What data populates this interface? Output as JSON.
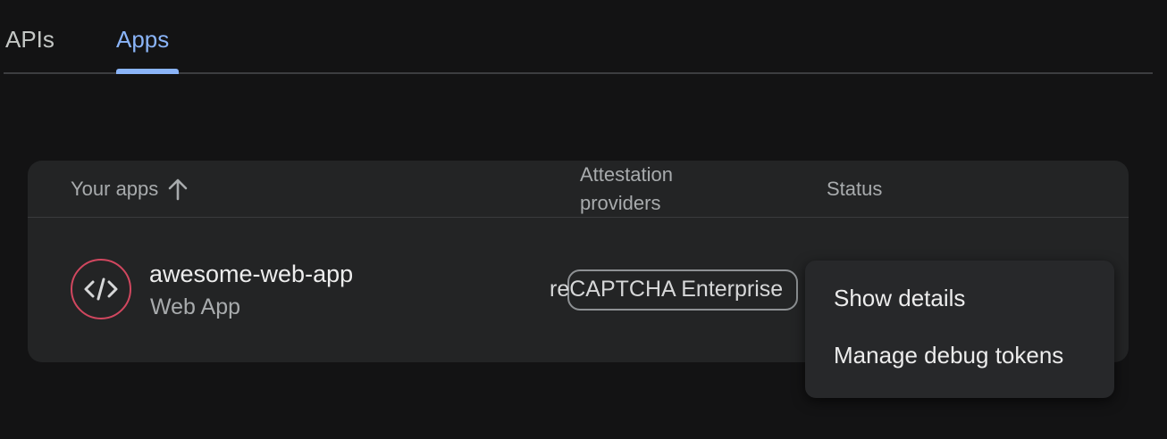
{
  "tabs": [
    {
      "label": "APIs",
      "active": false
    },
    {
      "label": "Apps",
      "active": true
    }
  ],
  "table": {
    "columns": {
      "apps": "Your apps",
      "attestation": "Attestation providers",
      "status": "Status"
    },
    "sort_icon": "arrow-up-icon",
    "rows": [
      {
        "name": "awesome-web-app",
        "type": "Web App",
        "icon": "code-icon",
        "provider": "reCAPTCHA Enterprise",
        "status": ""
      }
    ]
  },
  "menu": {
    "items": [
      "Show details",
      "Manage debug tokens"
    ]
  },
  "colors": {
    "background": "#131314",
    "card": "#232425",
    "accent": "#8ab4f8",
    "app_icon_ring": "#d1475f",
    "menu_bg": "#27282a"
  }
}
